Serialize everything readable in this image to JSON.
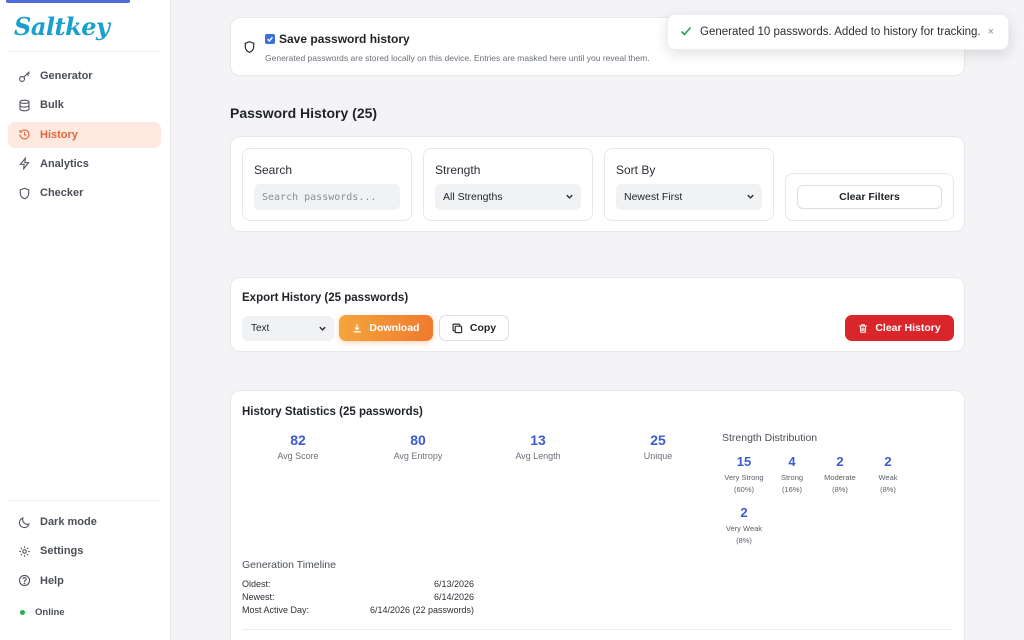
{
  "app": {
    "name": "Saltkey"
  },
  "sidebar": {
    "items": [
      {
        "label": "Generator",
        "icon": "key-icon"
      },
      {
        "label": "Bulk",
        "icon": "database-icon"
      },
      {
        "label": "History",
        "icon": "history-icon",
        "active": true
      },
      {
        "label": "Analytics",
        "icon": "lightning-icon"
      },
      {
        "label": "Checker",
        "icon": "shield-icon"
      }
    ],
    "bottom": [
      {
        "label": "Dark mode",
        "icon": "moon-icon"
      },
      {
        "label": "Settings",
        "icon": "gear-icon"
      },
      {
        "label": "Help",
        "icon": "help-icon"
      }
    ],
    "status": "Online"
  },
  "save_history": {
    "checked": true,
    "title": "Save password history",
    "description": "Generated passwords are stored locally on this device. Entries are masked here until you reveal them."
  },
  "toast": {
    "message": "Generated 10 passwords. Added to history for tracking.",
    "close": "×"
  },
  "history": {
    "title": "Password History (25)"
  },
  "filters": {
    "search": {
      "label": "Search",
      "placeholder": "Search passwords..."
    },
    "strength": {
      "label": "Strength",
      "value": "All Strengths"
    },
    "sort": {
      "label": "Sort By",
      "value": "Newest First"
    },
    "clear": "Clear Filters"
  },
  "export": {
    "title": "Export History (25 passwords)",
    "format": "Text",
    "download": "Download",
    "copy": "Copy",
    "clear_history": "Clear History"
  },
  "stats": {
    "title": "History Statistics (25 passwords)",
    "items": [
      {
        "value": "82",
        "label": "Avg Score"
      },
      {
        "value": "80",
        "label": "Avg Entropy"
      },
      {
        "value": "13",
        "label": "Avg Length"
      },
      {
        "value": "25",
        "label": "Unique"
      }
    ],
    "distribution_title": "Strength Distribution",
    "distribution": [
      {
        "value": "15",
        "label": "Very Strong",
        "pct": "(60%)"
      },
      {
        "value": "4",
        "label": "Strong",
        "pct": "(16%)"
      },
      {
        "value": "2",
        "label": "Moderate",
        "pct": "(8%)"
      },
      {
        "value": "2",
        "label": "Weak",
        "pct": "(8%)"
      },
      {
        "value": "2",
        "label": "Very Weak",
        "pct": "(8%)"
      }
    ],
    "timeline_title": "Generation Timeline",
    "timeline": [
      {
        "label": "Oldest:",
        "value": "6/13/2026"
      },
      {
        "label": "Newest:",
        "value": "6/14/2026"
      },
      {
        "label": "Most Active Day:",
        "value": "6/14/2026 (22 passwords)"
      }
    ]
  },
  "colors": {
    "accent": "#e0663a",
    "primary": "#3d5bd0",
    "danger": "#d8262b",
    "download": "#f07a2f",
    "brand": "#1aa0cc"
  }
}
